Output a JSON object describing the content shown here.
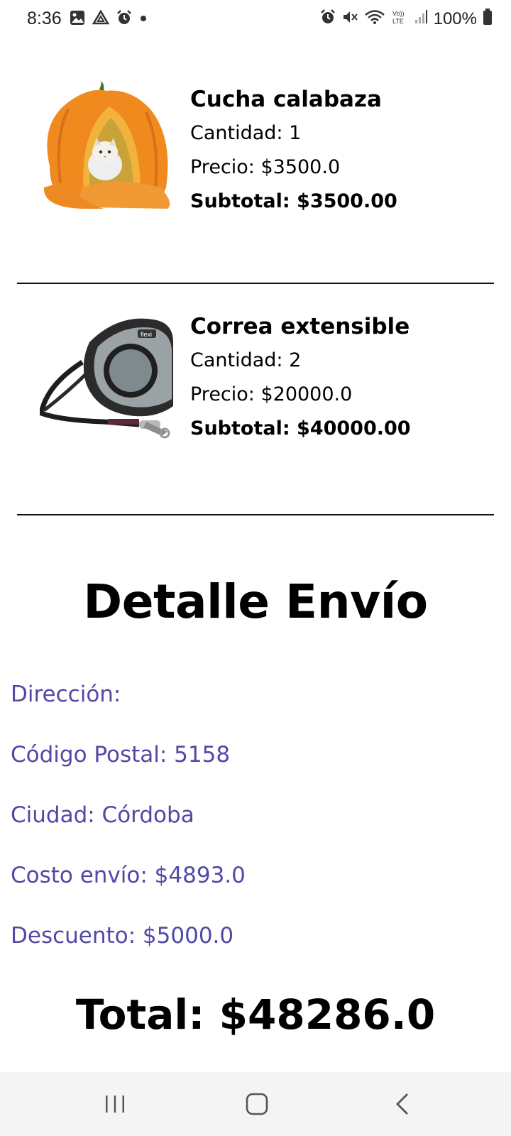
{
  "status_bar": {
    "time": "8:36",
    "battery": "100%",
    "icons_left": [
      "image-icon",
      "drive-icon",
      "alarm-icon",
      "dot-icon"
    ],
    "icons_right": [
      "alarm-icon",
      "mute-icon",
      "wifi-icon",
      "volte-icon",
      "signal-icon",
      "battery-icon"
    ]
  },
  "products": [
    {
      "name": "Cucha calabaza",
      "quantity": "Cantidad: 1",
      "price": "Precio: $3500.0",
      "subtotal": "Subtotal: $3500.00",
      "image": "pumpkin-bed-image"
    },
    {
      "name": "Correa extensible",
      "quantity": "Cantidad: 2",
      "price": "Precio: $20000.0",
      "subtotal": "Subtotal: $40000.00",
      "image": "retractable-leash-image"
    }
  ],
  "shipping": {
    "title": "Detalle Envío",
    "address": "Dirección:",
    "postal_code": "Código Postal: 5158",
    "city": "Ciudad: Córdoba",
    "shipping_cost": "Costo envío: $4893.0",
    "discount": "Descuento: $5000.0"
  },
  "total": "Total: $48286.0",
  "colors": {
    "detail_text": "#5148a8",
    "nav_bar": "#f4f4f4"
  },
  "nav_bar": {
    "buttons": [
      "recents-icon",
      "home-icon",
      "back-icon"
    ]
  }
}
